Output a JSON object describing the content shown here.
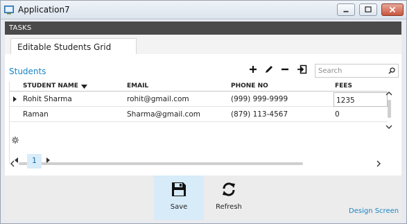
{
  "window": {
    "title": "Application7"
  },
  "tasks_label": "TASKS",
  "tab": {
    "label": "Editable Students Grid"
  },
  "section": {
    "title": "Students"
  },
  "search": {
    "placeholder": "Search",
    "value": ""
  },
  "toolbar": {
    "icons": [
      "add-icon",
      "edit-icon",
      "remove-icon",
      "export-icon"
    ]
  },
  "grid": {
    "columns": [
      "STUDENT NAME",
      "EMAIL",
      "PHONE NO",
      "FEES"
    ],
    "sorted_column": "STUDENT NAME",
    "rows": [
      {
        "name": "Rohit Sharma",
        "email": "rohit@gmail.com",
        "phone": "(999) 999-9999",
        "fees": "1235"
      },
      {
        "name": "Raman",
        "email": "Sharma@gmail.com",
        "phone": "(879) 113-4567",
        "fees": "0"
      }
    ]
  },
  "pager": {
    "current_page": "1"
  },
  "commands": {
    "save_label": "Save",
    "refresh_label": "Refresh"
  },
  "design_screen_label": "Design Screen",
  "colors": {
    "accent": "#1a84c6",
    "header_bar": "#4a4a4a",
    "selected_command": "#d7ebf8"
  }
}
